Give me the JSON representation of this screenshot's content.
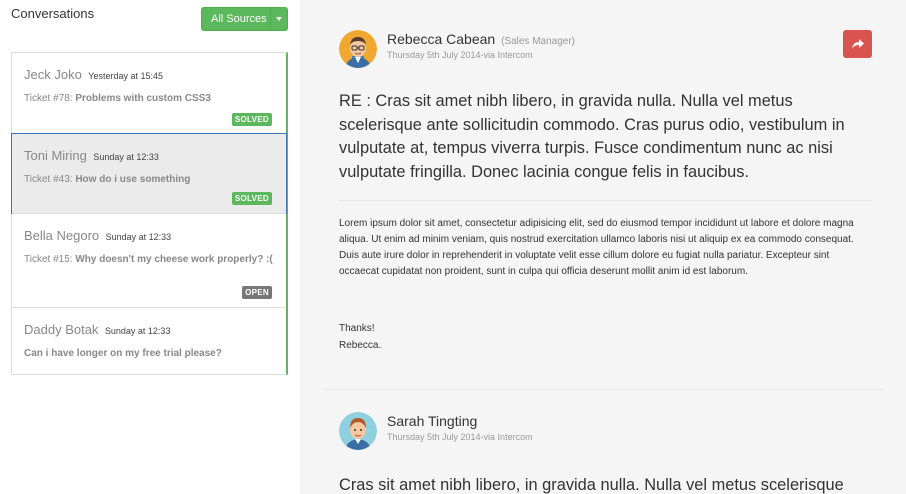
{
  "left": {
    "title": "Conversations",
    "sources_button": "All Sources",
    "conversations": [
      {
        "name": "Jeck Joko",
        "time": "Yesterday at 15:45",
        "ticket_prefix": "Ticket #78:",
        "ticket_subject": "Problems with custom CSS3",
        "status": "SOLVED"
      },
      {
        "name": "Toni Miring",
        "time": "Sunday at 12:33",
        "ticket_prefix": "Ticket #43:",
        "ticket_subject": "How do i use something",
        "status": "SOLVED"
      },
      {
        "name": "Bella Negoro",
        "time": "Sunday at 12:33",
        "ticket_prefix": "Ticket #15:",
        "ticket_subject": "Why doesn't my cheese work properly? :(",
        "status": "OPEN"
      },
      {
        "name": "Daddy Botak",
        "time": "Sunday at 12:33",
        "ticket_prefix": "",
        "ticket_subject": "Can i have longer on my free trial please?",
        "status": ""
      }
    ]
  },
  "messages": [
    {
      "author": "Rebecca Cabean",
      "role": "(Sales Manager)",
      "meta": "Thursday 5th July 2014-via Intercom",
      "lead": "RE : Cras sit amet nibh libero, in gravida nulla. Nulla vel metus scelerisque ante sollicitudin commodo. Cras purus odio, vestibulum in vulputate at, tempus viverra turpis. Fusce condimentum nunc ac nisi vulputate fringilla. Donec lacinia congue felis in faucibus.",
      "body": "Lorem ipsum dolor sit amet, consectetur adipisicing elit, sed do eiusmod tempor incididunt ut labore et dolore magna aliqua. Ut enim ad minim veniam, quis nostrud exercitation ullamco laboris nisi ut aliquip ex ea commodo consequat. Duis aute irure dolor in reprehenderit in voluptate velit esse cillum dolore eu fugiat nulla pariatur. Excepteur sint occaecat cupidatat non proident, sunt in culpa qui officia deserunt mollit anim id est laborum.",
      "thanks": "Thanks!",
      "signature": "Rebecca."
    },
    {
      "author": "Sarah Tingting",
      "meta": "Thursday 5th July 2014-via Intercom",
      "lead": "Cras sit amet nibh libero, in gravida nulla. Nulla vel metus scelerisque"
    }
  ],
  "colors": {
    "green": "#5cb85c",
    "red": "#d9534f",
    "grey_badge": "#777777",
    "active_border": "#337ab7"
  }
}
